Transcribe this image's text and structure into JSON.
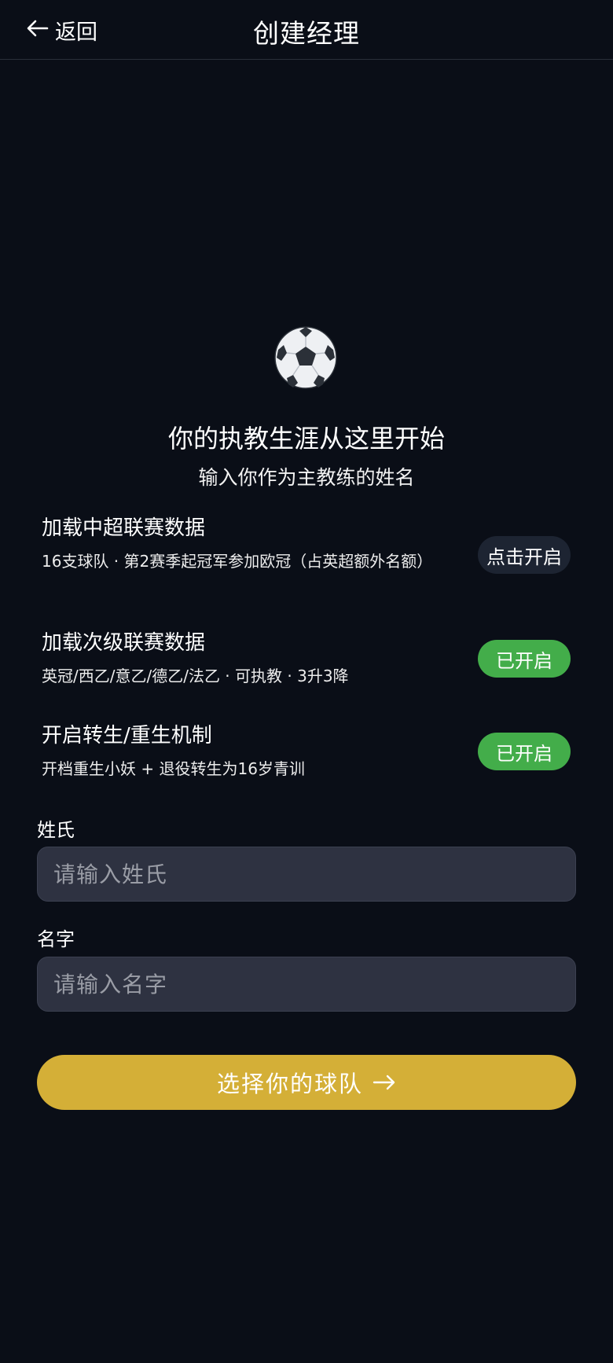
{
  "header": {
    "back_label": "返回",
    "title": "创建经理"
  },
  "hero": {
    "icon": "soccer-ball-icon",
    "title": "你的执教生涯从这里开始",
    "subtitle": "输入你作为主教练的姓名"
  },
  "options": [
    {
      "title": "加载中超联赛数据",
      "desc": "16支球队 · 第2赛季起冠军参加欧冠（占英超额外名额）",
      "toggle_label": "点击开启",
      "enabled": false
    },
    {
      "title": "加载次级联赛数据",
      "desc": "英冠/西乙/意乙/德乙/法乙 · 可执教 · 3升3降",
      "toggle_label": "已开启",
      "enabled": true
    },
    {
      "title": "开启转生/重生机制",
      "desc": "开档重生小妖 + 退役转生为16岁青训",
      "toggle_label": "已开启",
      "enabled": true
    }
  ],
  "form": {
    "surname_label": "姓氏",
    "surname_placeholder": "请输入姓氏",
    "surname_value": "",
    "given_label": "名字",
    "given_placeholder": "请输入名字",
    "given_value": ""
  },
  "cta": {
    "label": "选择你的球队",
    "icon": "arrow-right-icon"
  },
  "colors": {
    "background": "#0a0e17",
    "accent": "#d4af37",
    "enabled": "#43ad4a",
    "disabled_pill": "#1d2432",
    "input_bg": "#2e3241"
  }
}
